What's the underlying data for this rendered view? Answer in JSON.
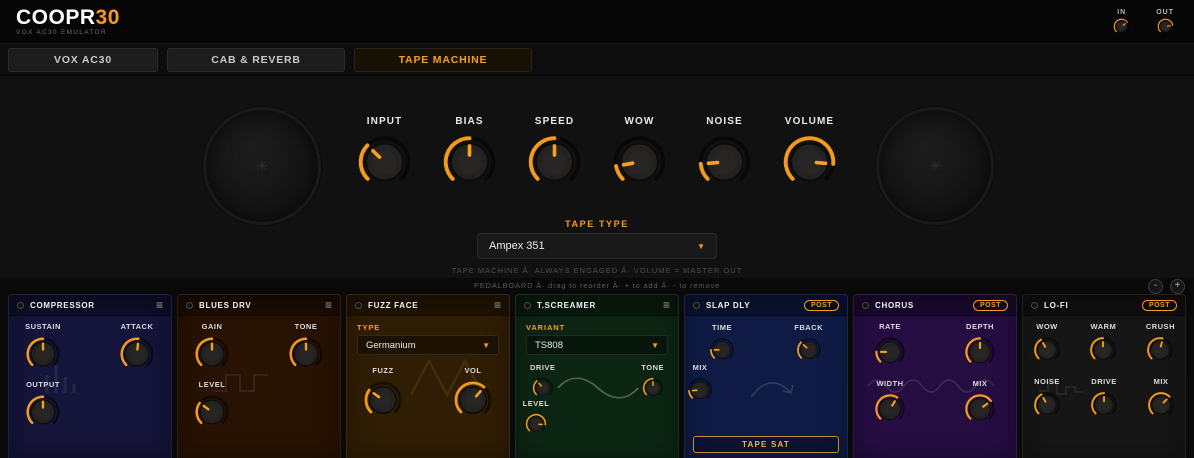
{
  "accent": "#f59b1e",
  "icons": {
    "menu": "≡",
    "caret": "▼",
    "reel": "✳",
    "minus": "-",
    "plus": "+"
  },
  "header": {
    "brand": "COOPR",
    "brand_accent": "30",
    "subtitle": "VOX AC30 EMULATOR",
    "in_label": "IN",
    "out_label": "OUT",
    "in_knob": 0.7,
    "out_knob": 0.8
  },
  "tabs": [
    {
      "label": "VOX AC30",
      "active": false
    },
    {
      "label": "CAB & REVERB",
      "active": false
    },
    {
      "label": "TAPE MACHINE",
      "active": true
    }
  ],
  "tape_machine": {
    "knobs": [
      {
        "label": "INPUT",
        "value": 0.33
      },
      {
        "label": "BIAS",
        "value": 0.5
      },
      {
        "label": "SPEED",
        "value": 0.5
      },
      {
        "label": "WOW",
        "value": 0.13
      },
      {
        "label": "NOISE",
        "value": 0.15
      },
      {
        "label": "VOLUME",
        "value": 0.85
      }
    ],
    "tape_type_label": "TAPE TYPE",
    "tape_type_value": "Ampex 351",
    "footnote": "TAPE MACHINE Â· ALWAYS ENGAGED Â· VOLUME = MASTER OUT"
  },
  "pedalboard": {
    "hint": "PEDALBOARD Â·  drag to reorder  Â·  + to add  Â·  - to remove",
    "remove_label": "-",
    "add_label": "+",
    "pedals": [
      {
        "name": "COMPRESSOR",
        "color": "#15143a",
        "knobs": [
          {
            "label": "SUSTAIN",
            "value": 0.5
          },
          {
            "label": "ATTACK",
            "value": 0.52
          },
          {
            "label": "OUTPUT",
            "value": 0.5
          }
        ]
      },
      {
        "name": "BLUES DRV",
        "color": "#271203",
        "knobs": [
          {
            "label": "GAIN",
            "value": 0.5
          },
          {
            "label": "TONE",
            "value": 0.5
          },
          {
            "label": "LEVEL",
            "value": 0.3
          }
        ]
      },
      {
        "name": "FUZZ FACE",
        "color": "#2f1d04",
        "type_label": "TYPE",
        "type_value": "Germanium",
        "knobs": [
          {
            "label": "FUZZ",
            "value": 0.3
          },
          {
            "label": "VOL",
            "value": 0.65
          }
        ]
      },
      {
        "name": "T.SCREAMER",
        "color": "#0c2513",
        "type_label": "VARIANT",
        "type_value": "TS808",
        "knobs": [
          {
            "label": "DRIVE",
            "value": 0.35
          },
          {
            "label": "TONE",
            "value": 0.5
          },
          {
            "label": "LEVEL",
            "value": 0.85
          }
        ]
      },
      {
        "name": "SLAP DLY",
        "color": "#0f1b45",
        "badge": "POST",
        "button": "TAPE SAT",
        "knobs": [
          {
            "label": "TIME",
            "value": 0.17
          },
          {
            "label": "FBACK",
            "value": 0.33
          },
          {
            "label": "MIX",
            "value": 0.15
          }
        ]
      },
      {
        "name": "CHORUS",
        "color": "#250d42",
        "badge": "POST",
        "knobs": [
          {
            "label": "RATE",
            "value": 0.17
          },
          {
            "label": "DEPTH",
            "value": 0.5
          },
          {
            "label": "WIDTH",
            "value": 0.62
          },
          {
            "label": "MIX",
            "value": 0.7
          }
        ]
      },
      {
        "name": "LO-FI",
        "color": "#161616",
        "badge": "POST",
        "knobs": [
          {
            "label": "WOW",
            "value": 0.39
          },
          {
            "label": "WARM",
            "value": 0.5
          },
          {
            "label": "CRUSH",
            "value": 0.55
          },
          {
            "label": "NOISE",
            "value": 0.4
          },
          {
            "label": "DRIVE",
            "value": 0.5
          },
          {
            "label": "MIX",
            "value": 0.67
          }
        ]
      }
    ]
  }
}
